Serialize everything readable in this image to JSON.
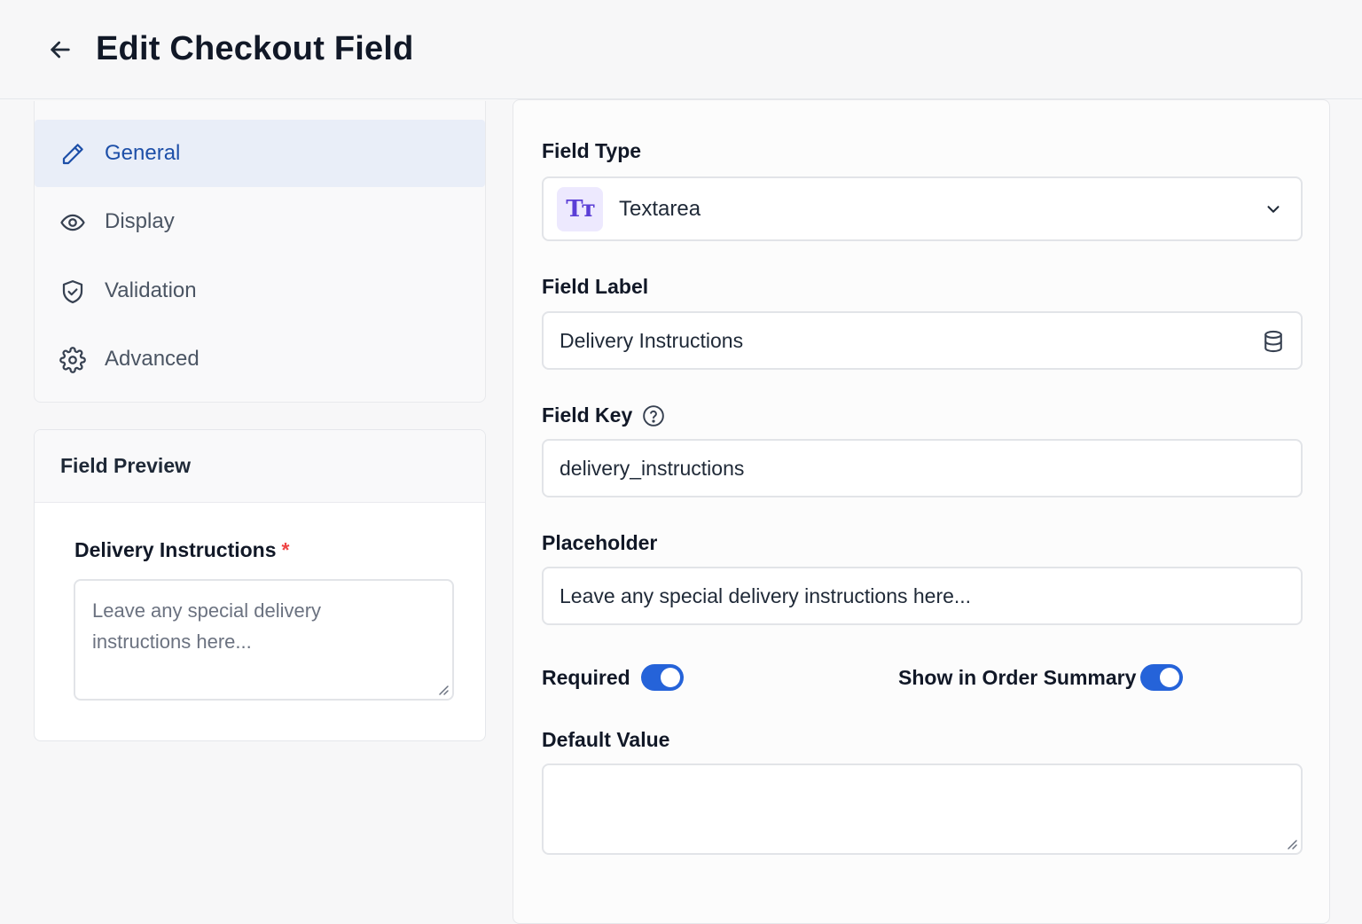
{
  "header": {
    "title": "Edit Checkout Field"
  },
  "sidebar": {
    "items": [
      {
        "label": "General",
        "icon": "pencil-icon",
        "active": true
      },
      {
        "label": "Display",
        "icon": "eye-icon",
        "active": false
      },
      {
        "label": "Validation",
        "icon": "shield-check-icon",
        "active": false
      },
      {
        "label": "Advanced",
        "icon": "gear-icon",
        "active": false
      }
    ]
  },
  "preview": {
    "title": "Field Preview",
    "field_label": "Delivery Instructions",
    "required_marker": "*",
    "placeholder_line1": "Leave any special delivery",
    "placeholder_line2": "instructions here..."
  },
  "form": {
    "field_type": {
      "label": "Field Type",
      "value": "Textarea",
      "badge": "Tт"
    },
    "field_label": {
      "label": "Field Label",
      "value": "Delivery Instructions"
    },
    "field_key": {
      "label": "Field Key",
      "value": "delivery_instructions"
    },
    "placeholder": {
      "label": "Placeholder",
      "value": "Leave any special delivery instructions here..."
    },
    "required": {
      "label": "Required",
      "on": true
    },
    "show_in_summary": {
      "label": "Show in Order Summary",
      "on": true
    },
    "default_value": {
      "label": "Default Value",
      "value": ""
    }
  },
  "colors": {
    "accent": "#2563d9",
    "active_nav_bg": "#e9eef8",
    "active_nav_text": "#1d4fa8",
    "required_star": "#ef4444"
  }
}
